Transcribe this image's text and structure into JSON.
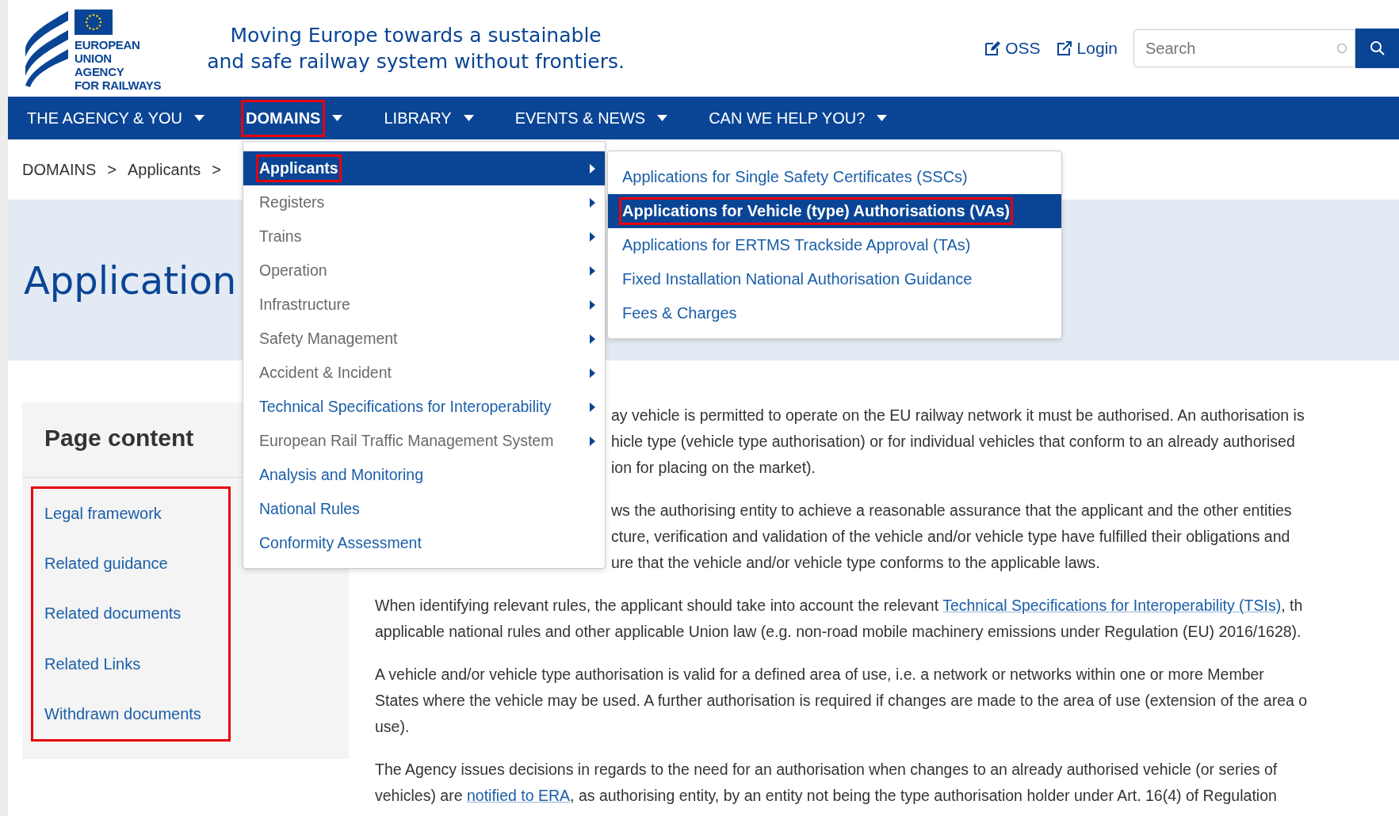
{
  "header": {
    "logo_lines": [
      "EUROPEAN",
      "UNION",
      "AGENCY",
      "FOR RAILWAYS"
    ],
    "tagline": [
      "Moving Europe towards a sustainable",
      "and safe railway system without frontiers."
    ],
    "links": [
      {
        "label": "OSS",
        "kind": "edit"
      },
      {
        "label": "Login",
        "kind": "external"
      }
    ],
    "search": {
      "placeholder": "Search"
    }
  },
  "nav": [
    {
      "label": "THE AGENCY & YOU",
      "selected": false,
      "highlighted": false
    },
    {
      "label": "DOMAINS",
      "selected": true,
      "highlighted": true
    },
    {
      "label": "LIBRARY",
      "selected": false,
      "highlighted": false
    },
    {
      "label": "EVENTS & NEWS",
      "selected": false,
      "highlighted": false
    },
    {
      "label": "CAN WE HELP YOU?",
      "selected": false,
      "highlighted": false
    }
  ],
  "breadcrumb": [
    "DOMAINS",
    ">",
    "Applicants",
    ">"
  ],
  "page_title": "Application",
  "menu": {
    "items": [
      {
        "label": "Applicants",
        "selected": true,
        "highlighted": true,
        "has_submenu": true,
        "linked": false
      },
      {
        "label": "Registers",
        "selected": false,
        "highlighted": false,
        "has_submenu": true,
        "linked": false
      },
      {
        "label": "Trains",
        "selected": false,
        "highlighted": false,
        "has_submenu": true,
        "linked": false
      },
      {
        "label": "Operation",
        "selected": false,
        "highlighted": false,
        "has_submenu": true,
        "linked": false
      },
      {
        "label": "Infrastructure",
        "selected": false,
        "highlighted": false,
        "has_submenu": true,
        "linked": false
      },
      {
        "label": "Safety Management",
        "selected": false,
        "highlighted": false,
        "has_submenu": true,
        "linked": false
      },
      {
        "label": "Accident & Incident",
        "selected": false,
        "highlighted": false,
        "has_submenu": true,
        "linked": false
      },
      {
        "label": "Technical Specifications for Interoperability",
        "selected": false,
        "highlighted": false,
        "has_submenu": true,
        "linked": true
      },
      {
        "label": "European Rail Traffic Management System",
        "selected": false,
        "highlighted": false,
        "has_submenu": true,
        "linked": false
      },
      {
        "label": "Analysis and Monitoring",
        "selected": false,
        "highlighted": false,
        "has_submenu": false,
        "linked": true
      },
      {
        "label": "National Rules",
        "selected": false,
        "highlighted": false,
        "has_submenu": false,
        "linked": true
      },
      {
        "label": "Conformity Assessment",
        "selected": false,
        "highlighted": false,
        "has_submenu": false,
        "linked": true
      }
    ],
    "submenu": [
      {
        "label": "Applications for Single Safety Certificates (SSCs)",
        "selected": false,
        "highlighted": false
      },
      {
        "label": "Applications for Vehicle (type) Authorisations (VAs)",
        "selected": true,
        "highlighted": true
      },
      {
        "label": "Applications for ERTMS Trackside Approval (TAs)",
        "selected": false,
        "highlighted": false
      },
      {
        "label": "Fixed Installation National Authorisation Guidance",
        "selected": false,
        "highlighted": false
      },
      {
        "label": "Fees & Charges",
        "selected": false,
        "highlighted": false
      }
    ]
  },
  "sidebar": {
    "title": "Page content",
    "highlighted": true,
    "links": [
      "Legal framework",
      "Related guidance",
      "Related documents",
      "Related Links",
      "Withdrawn documents"
    ]
  },
  "article": [
    {
      "covered_by_menu": true,
      "lines": [
        [
          {
            "text": "ay vehicle is permitted to operate on the EU railway network it must be authorised. An authorisation is"
          }
        ],
        [
          {
            "text": "hicle type (vehicle type authorisation) or for individual vehicles that conform to an already authorised"
          }
        ],
        [
          {
            "text": "ion for placing on the market)."
          }
        ]
      ]
    },
    {
      "covered_by_menu": true,
      "lines": [
        [
          {
            "text": "ws the authorising entity to achieve a reasonable assurance that the applicant and the other entities"
          }
        ],
        [
          {
            "text": "cture, verification and validation of the vehicle and/or vehicle type have fulfilled their obligations and"
          }
        ],
        [
          {
            "text": "ure that the vehicle and/or vehicle type conforms to the applicable laws."
          }
        ]
      ]
    },
    {
      "covered_by_menu": false,
      "lines": [
        [
          {
            "text": "When identifying relevant rules, the applicant should take into account the relevant "
          },
          {
            "text": "Technical Specifications for Interoperability (TSIs)",
            "link": true
          },
          {
            "text": ", th"
          }
        ],
        [
          {
            "text": "applicable national rules and other applicable Union law (e.g. non-road mobile machinery emissions under Regulation (EU) 2016/1628)."
          }
        ]
      ]
    },
    {
      "covered_by_menu": false,
      "lines": [
        [
          {
            "text": "A vehicle and/or vehicle type authorisation is valid for a defined area of use, i.e. a network or networks within one or more Member"
          }
        ],
        [
          {
            "text": "States where the vehicle may be used. A further authorisation is required if changes are made to the area of use (extension of the area o"
          }
        ],
        [
          {
            "text": "use)."
          }
        ]
      ]
    },
    {
      "covered_by_menu": false,
      "lines": [
        [
          {
            "text": "The Agency issues decisions in regards to the need for an authorisation when changes to an already authorised vehicle (or series of"
          }
        ],
        [
          {
            "text": "vehicles) are "
          },
          {
            "text": "notified to ERA",
            "link": true
          },
          {
            "text": ", as authorising entity, by an entity not being the type authorisation holder under Art. 16(4) of Regulation"
          }
        ]
      ]
    }
  ]
}
